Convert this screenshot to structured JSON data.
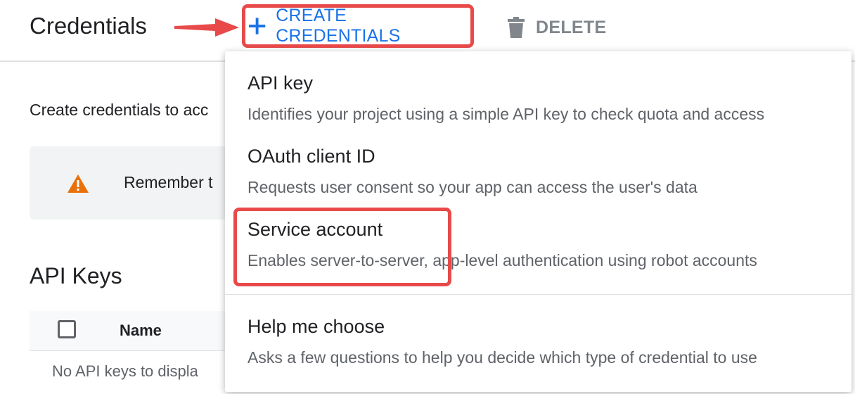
{
  "header": {
    "title": "Credentials",
    "create_button": {
      "label": "CREATE CREDENTIALS",
      "icon": "plus-icon"
    },
    "delete_button": {
      "label": "DELETE",
      "icon": "trash-icon"
    }
  },
  "content": {
    "intro_text": "Create credentials to acc",
    "warning": {
      "icon": "warning-icon",
      "text": "Remember t"
    },
    "api_keys": {
      "title": "API Keys",
      "columns": [
        "Name"
      ],
      "empty_text": "No API keys to displa"
    }
  },
  "menu": {
    "items": [
      {
        "title": "API key",
        "description": "Identifies your project using a simple API key to check quota and access"
      },
      {
        "title": "OAuth client ID",
        "description": "Requests user consent so your app can access the user's data"
      },
      {
        "title": "Service account",
        "description": "Enables server-to-server, app-level authentication using robot accounts"
      },
      {
        "title": "Help me choose",
        "description": "Asks a few questions to help you decide which type of credential to use"
      }
    ]
  },
  "colors": {
    "accent": "#1a73e8",
    "annotation": "#e84a4a",
    "warning": "#e8710a",
    "muted": "#80868b"
  }
}
